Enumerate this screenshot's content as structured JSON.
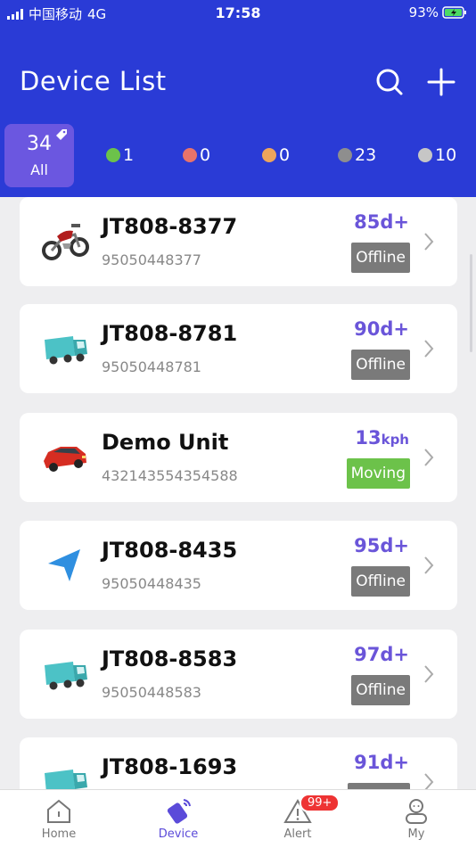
{
  "status_bar": {
    "carrier": "中国移动",
    "network": "4G",
    "time": "17:58",
    "battery": "93%"
  },
  "header": {
    "title": "Device List"
  },
  "filter_tabs": {
    "all": {
      "count": "34",
      "label": "All"
    },
    "items": [
      {
        "count": "1",
        "color": "#6cc24a",
        "status": "green"
      },
      {
        "count": "0",
        "color": "#e8736b",
        "status": "red"
      },
      {
        "count": "0",
        "color": "#eda55c",
        "status": "orange"
      },
      {
        "count": "23",
        "color": "#8e8e8e",
        "status": "gray"
      },
      {
        "count": "10",
        "color": "#c6c6c6",
        "status": "light-gray"
      }
    ]
  },
  "devices": [
    {
      "name": "JT808-8377",
      "imei": "95050448377",
      "duration": "85",
      "unit": "d+",
      "status": "Offline",
      "status_color": "#7a7a7a",
      "icon": "motorcycle-icon"
    },
    {
      "name": "JT808-8781",
      "imei": "95050448781",
      "duration": "90",
      "unit": "d+",
      "status": "Offline",
      "status_color": "#7a7a7a",
      "icon": "truck-icon"
    },
    {
      "name": "Demo Unit",
      "imei": "432143554354588",
      "duration": "13",
      "unit": "kph",
      "status": "Moving",
      "status_color": "#6cc24a",
      "icon": "car-icon"
    },
    {
      "name": "JT808-8435",
      "imei": "95050448435",
      "duration": "95",
      "unit": "d+",
      "status": "Offline",
      "status_color": "#7a7a7a",
      "icon": "navigation-arrow-icon"
    },
    {
      "name": "JT808-8583",
      "imei": "95050448583",
      "duration": "97",
      "unit": "d+",
      "status": "Offline",
      "status_color": "#7a7a7a",
      "icon": "truck-icon"
    },
    {
      "name": "JT808-1693",
      "imei": "",
      "duration": "91",
      "unit": "d+",
      "status": "",
      "status_color": "#7a7a7a",
      "icon": "truck-icon"
    }
  ],
  "bottom_nav": {
    "items": [
      {
        "label": "Home",
        "icon": "home-icon"
      },
      {
        "label": "Device",
        "icon": "device-icon"
      },
      {
        "label": "Alert",
        "icon": "alert-icon",
        "badge": "99+"
      },
      {
        "label": "My",
        "icon": "user-icon"
      }
    ]
  },
  "colors": {
    "header": "#2a3bd6",
    "accent": "#6a55d9",
    "all_tab": "#6b57e0"
  }
}
